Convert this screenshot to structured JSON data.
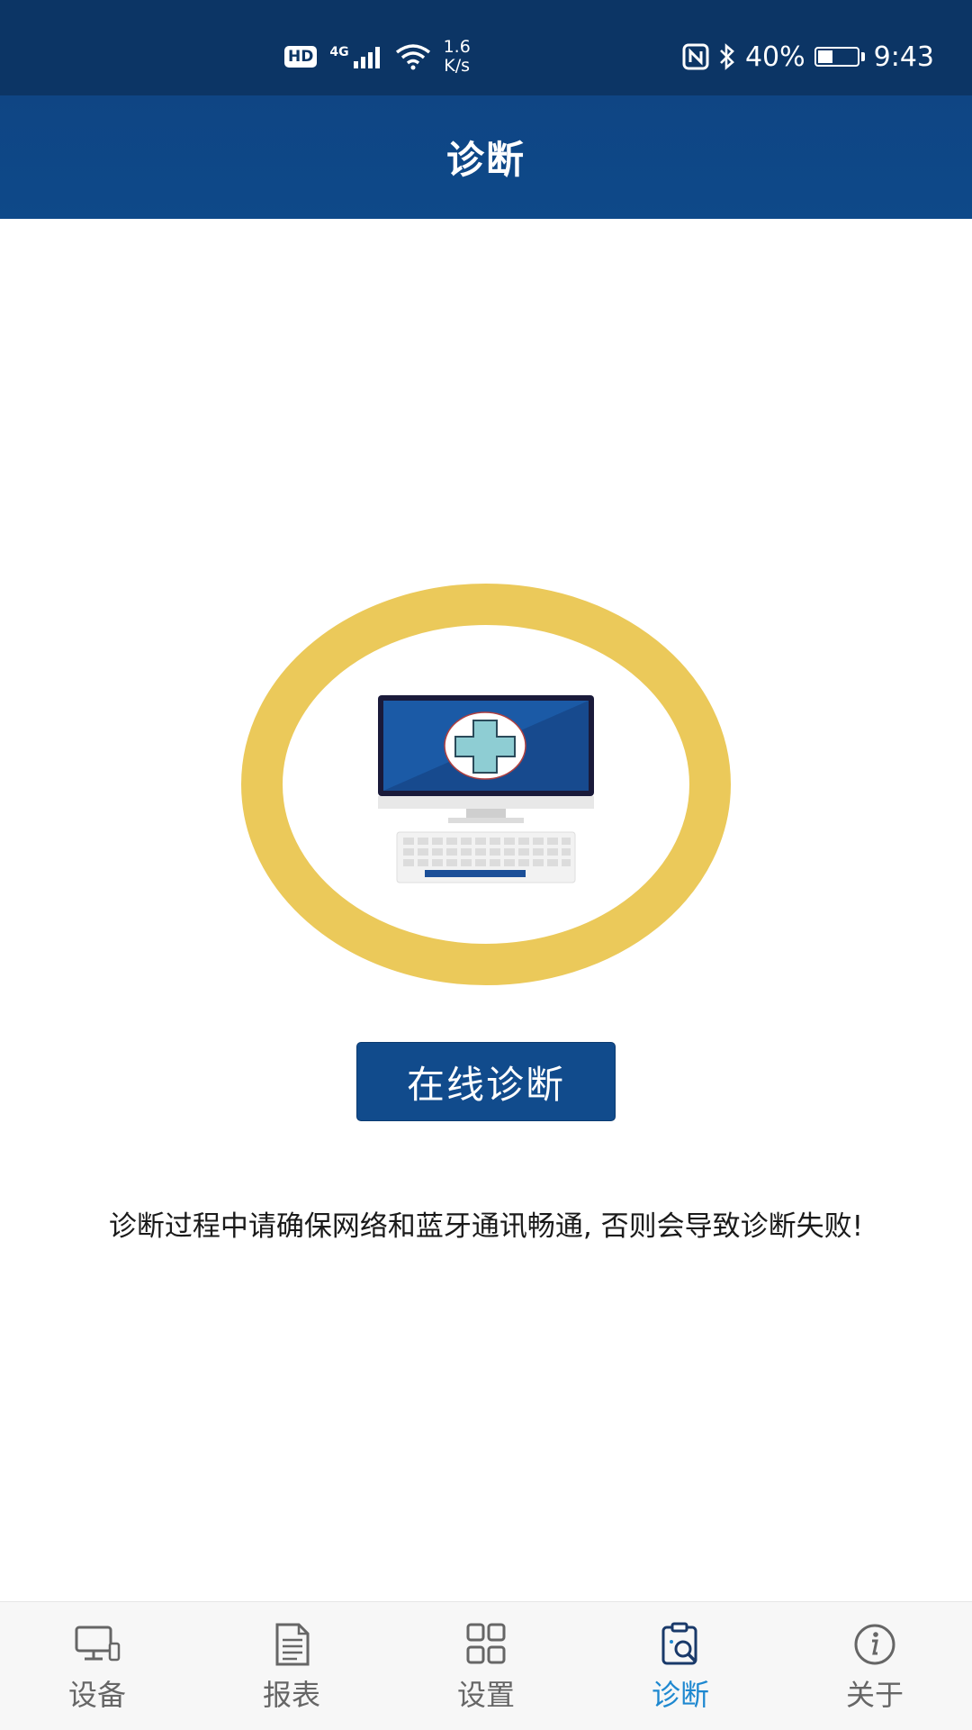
{
  "status_bar": {
    "hd": "HD",
    "network": "4G",
    "speed_value": "1.6",
    "speed_unit": "K/s",
    "battery_percent": "40%",
    "battery_level": 0.4,
    "time": "9:43"
  },
  "header": {
    "title": "诊断"
  },
  "main": {
    "illustration_icon": "computer-diagnosis-icon",
    "button_label": "在线诊断",
    "notice": "诊断过程中请确保网络和蓝牙通讯畅通, 否则会导致诊断失败!"
  },
  "bottom_nav": {
    "items": [
      {
        "label": "设备",
        "icon": "device-icon",
        "active": false
      },
      {
        "label": "报表",
        "icon": "report-icon",
        "active": false
      },
      {
        "label": "设置",
        "icon": "grid-icon",
        "active": false
      },
      {
        "label": "诊断",
        "icon": "diagnosis-icon",
        "active": true
      },
      {
        "label": "关于",
        "icon": "info-icon",
        "active": false
      }
    ]
  },
  "colors": {
    "header_blue": "#0f4584",
    "ring_yellow": "#ebc95a",
    "active_tab": "#1e88d0",
    "inactive_tab": "#666666"
  }
}
